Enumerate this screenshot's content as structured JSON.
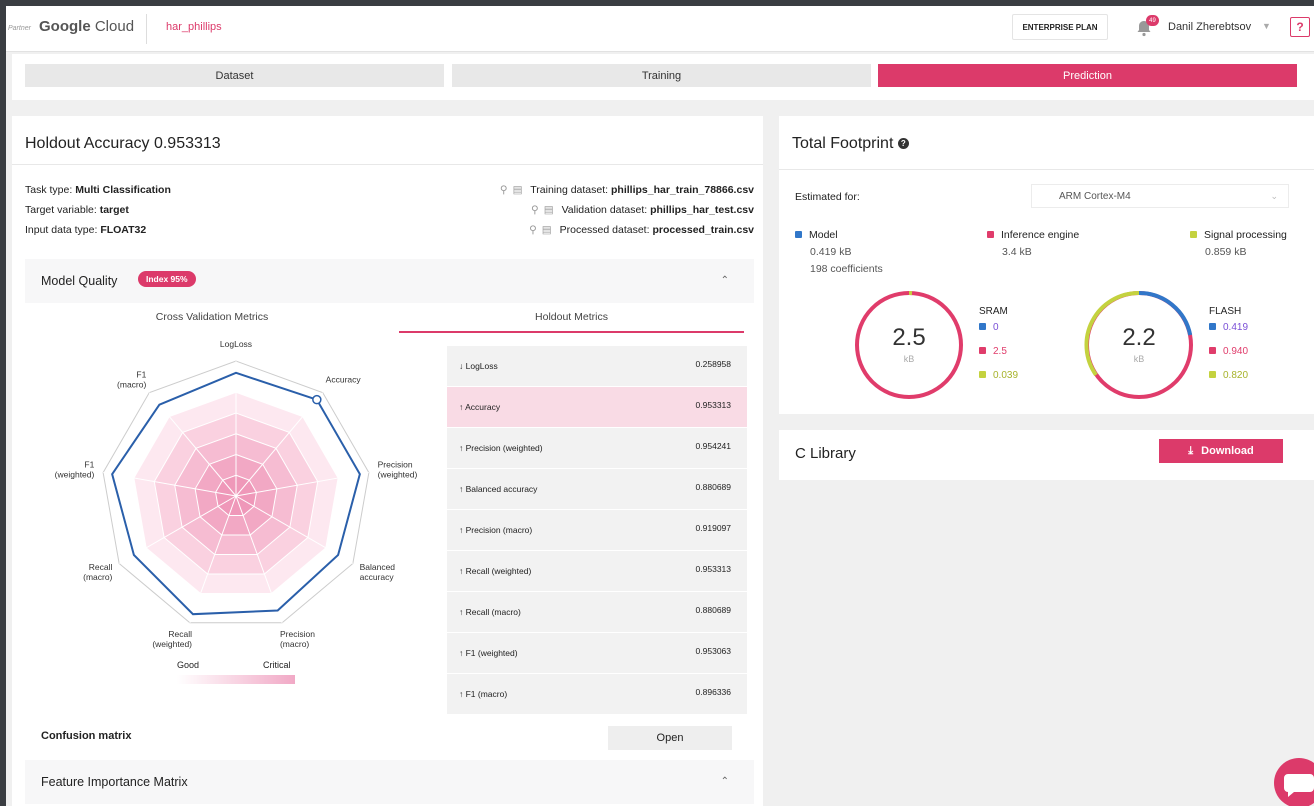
{
  "header": {
    "partner": "Partner",
    "brand_google": "Google",
    "brand_cloud": "Cloud",
    "project": "har_phillips",
    "plan_button": "ENTERPRISE PLAN",
    "notifications": "49",
    "user": "Danil Zherebtsov",
    "help": "?"
  },
  "steps": [
    {
      "label": "Dataset",
      "active": false
    },
    {
      "label": "Training",
      "active": false
    },
    {
      "label": "Prediction",
      "active": true
    }
  ],
  "holdout": {
    "title": "Holdout Accuracy 0.953313",
    "task_type_label": "Task type:",
    "task_type": "Multi Classification",
    "target_label": "Target variable:",
    "target": "target",
    "input_label": "Input data type:",
    "input": "FLOAT32",
    "training_label": "Training dataset:",
    "training": "phillips_har_train_78866.csv",
    "validation_label": "Validation dataset:",
    "validation": "phillips_har_test.csv",
    "processed_label": "Processed dataset:",
    "processed": "processed_train.csv"
  },
  "quality": {
    "title": "Model Quality",
    "badge": "Index 95%",
    "tab_cv": "Cross Validation Metrics",
    "tab_holdout": "Holdout Metrics",
    "radar_labels": [
      "LogLoss",
      "Accuracy",
      "Precision\n(weighted)",
      "Balanced\naccuracy",
      "Precision\n(macro)",
      "Recall\n(weighted)",
      "Recall\n(macro)",
      "F1\n(weighted)",
      "F1\n(macro)"
    ],
    "scale_good": "Good",
    "scale_critical": "Critical",
    "metrics": [
      {
        "label": "↓ LogLoss",
        "value": "0.258958",
        "highlight": false
      },
      {
        "label": "↑ Accuracy",
        "value": "0.953313",
        "highlight": true
      },
      {
        "label": "↑ Precision (weighted)",
        "value": "0.954241",
        "highlight": false
      },
      {
        "label": "↑ Balanced accuracy",
        "value": "0.880689",
        "highlight": false
      },
      {
        "label": "↑ Precision (macro)",
        "value": "0.919097",
        "highlight": false
      },
      {
        "label": "↑ Recall (weighted)",
        "value": "0.953313",
        "highlight": false
      },
      {
        "label": "↑ Recall (macro)",
        "value": "0.880689",
        "highlight": false
      },
      {
        "label": "↑ F1 (weighted)",
        "value": "0.953063",
        "highlight": false
      },
      {
        "label": "↑ F1 (macro)",
        "value": "0.896336",
        "highlight": false
      }
    ],
    "confusion_label": "Confusion matrix",
    "open_button": "Open",
    "feature_title": "Feature Importance Matrix"
  },
  "chart_data": {
    "type": "radar",
    "categories": [
      "LogLoss",
      "Accuracy",
      "Precision (weighted)",
      "Balanced accuracy",
      "Precision (macro)",
      "Recall (weighted)",
      "Recall (macro)",
      "F1 (weighted)",
      "F1 (macro)"
    ],
    "series": [
      {
        "values": [
          0.94,
          0.96,
          0.96,
          0.9,
          0.93,
          0.96,
          0.9,
          0.96,
          0.91
        ]
      }
    ],
    "highlight_index": 1,
    "rings": 5,
    "colors": {
      "line": "#2a5faa",
      "fill": "#f1a9c6"
    }
  },
  "footprint": {
    "title": "Total Footprint",
    "estimated_label": "Estimated for:",
    "target": "ARM Cortex-M4",
    "legend": [
      {
        "name": "Model",
        "value": "0.419 kB",
        "extra": "198 coefficients",
        "color": "#3177c9"
      },
      {
        "name": "Inference engine",
        "value": "3.4 kB",
        "extra": "",
        "color": "#e03c6b"
      },
      {
        "name": "Signal processing",
        "value": "0.859 kB",
        "extra": "",
        "color": "#c4d23f"
      }
    ],
    "sram": {
      "value": "2.5",
      "unit": "kB",
      "label": "SRAM",
      "items": [
        "0",
        "2.5",
        "0.039"
      ]
    },
    "flash": {
      "value": "2.2",
      "unit": "kB",
      "label": "FLASH",
      "items": [
        "0.419",
        "0.940",
        "0.820"
      ]
    }
  },
  "library": {
    "title": "C Library",
    "download": "Download"
  }
}
